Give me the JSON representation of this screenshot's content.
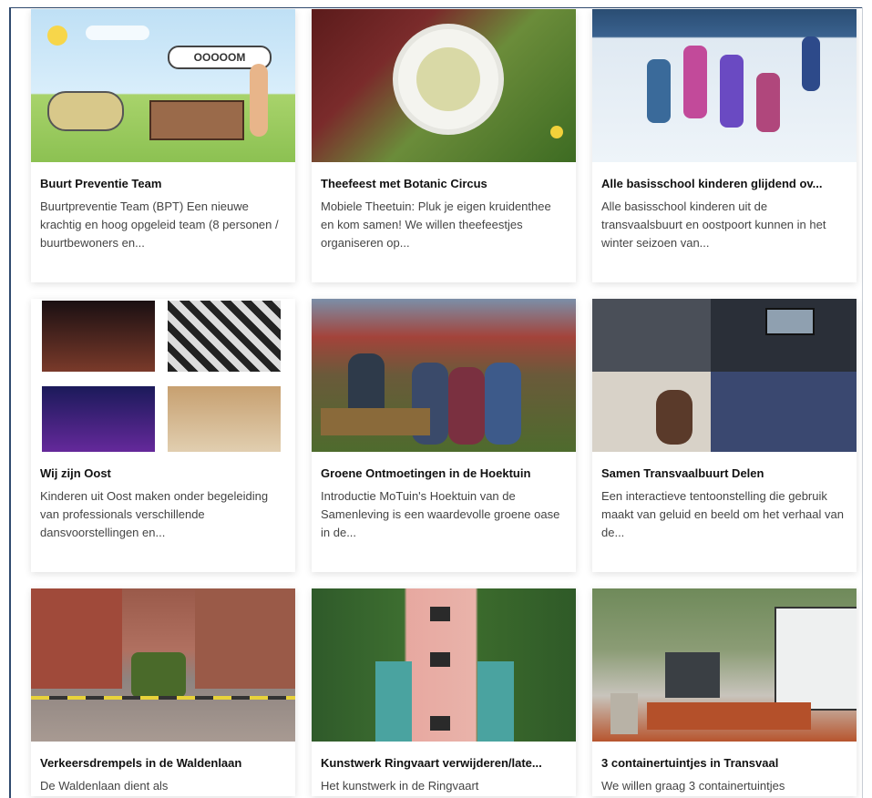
{
  "cards": [
    {
      "title": "Buurt Preventie Team",
      "desc": "Buurtpreventie Team (BPT) Een nieuwe krachtig en hoog opgeleid team (8 personen / buurtbewoners en..."
    },
    {
      "title": "Theefeest met Botanic Circus",
      "desc": "Mobiele Theetuin: Pluk je eigen kruidenthee en kom samen! We willen theefeestjes organiseren op..."
    },
    {
      "title": "Alle basisschool kinderen glijdend ov...",
      "desc": "Alle basisschool kinderen uit de transvaalsbuurt en oostpoort kunnen in het winter seizoen van..."
    },
    {
      "title": "Wij zijn Oost",
      "desc": "Kinderen uit Oost maken onder begeleiding van professionals verschillende dansvoorstellingen en..."
    },
    {
      "title": "Groene Ontmoetingen in de Hoektuin",
      "desc": "Introductie MoTuin's Hoektuin van de Samenleving is een waardevolle groene oase in de..."
    },
    {
      "title": "Samen Transvaalbuurt Delen",
      "desc": "Een interactieve tentoonstelling die gebruik maakt van geluid en beeld om het verhaal van de..."
    },
    {
      "title": "Verkeersdrempels in de Waldenlaan",
      "desc": "De Waldenlaan dient als"
    },
    {
      "title": "Kunstwerk Ringvaart verwijderen/late...",
      "desc": "Het kunstwerk in de Ringvaart"
    },
    {
      "title": "3 containertuintjes in Transvaal",
      "desc": "We willen graag 3 containertuintjes"
    }
  ],
  "cartoon_text": "OOOOOM"
}
